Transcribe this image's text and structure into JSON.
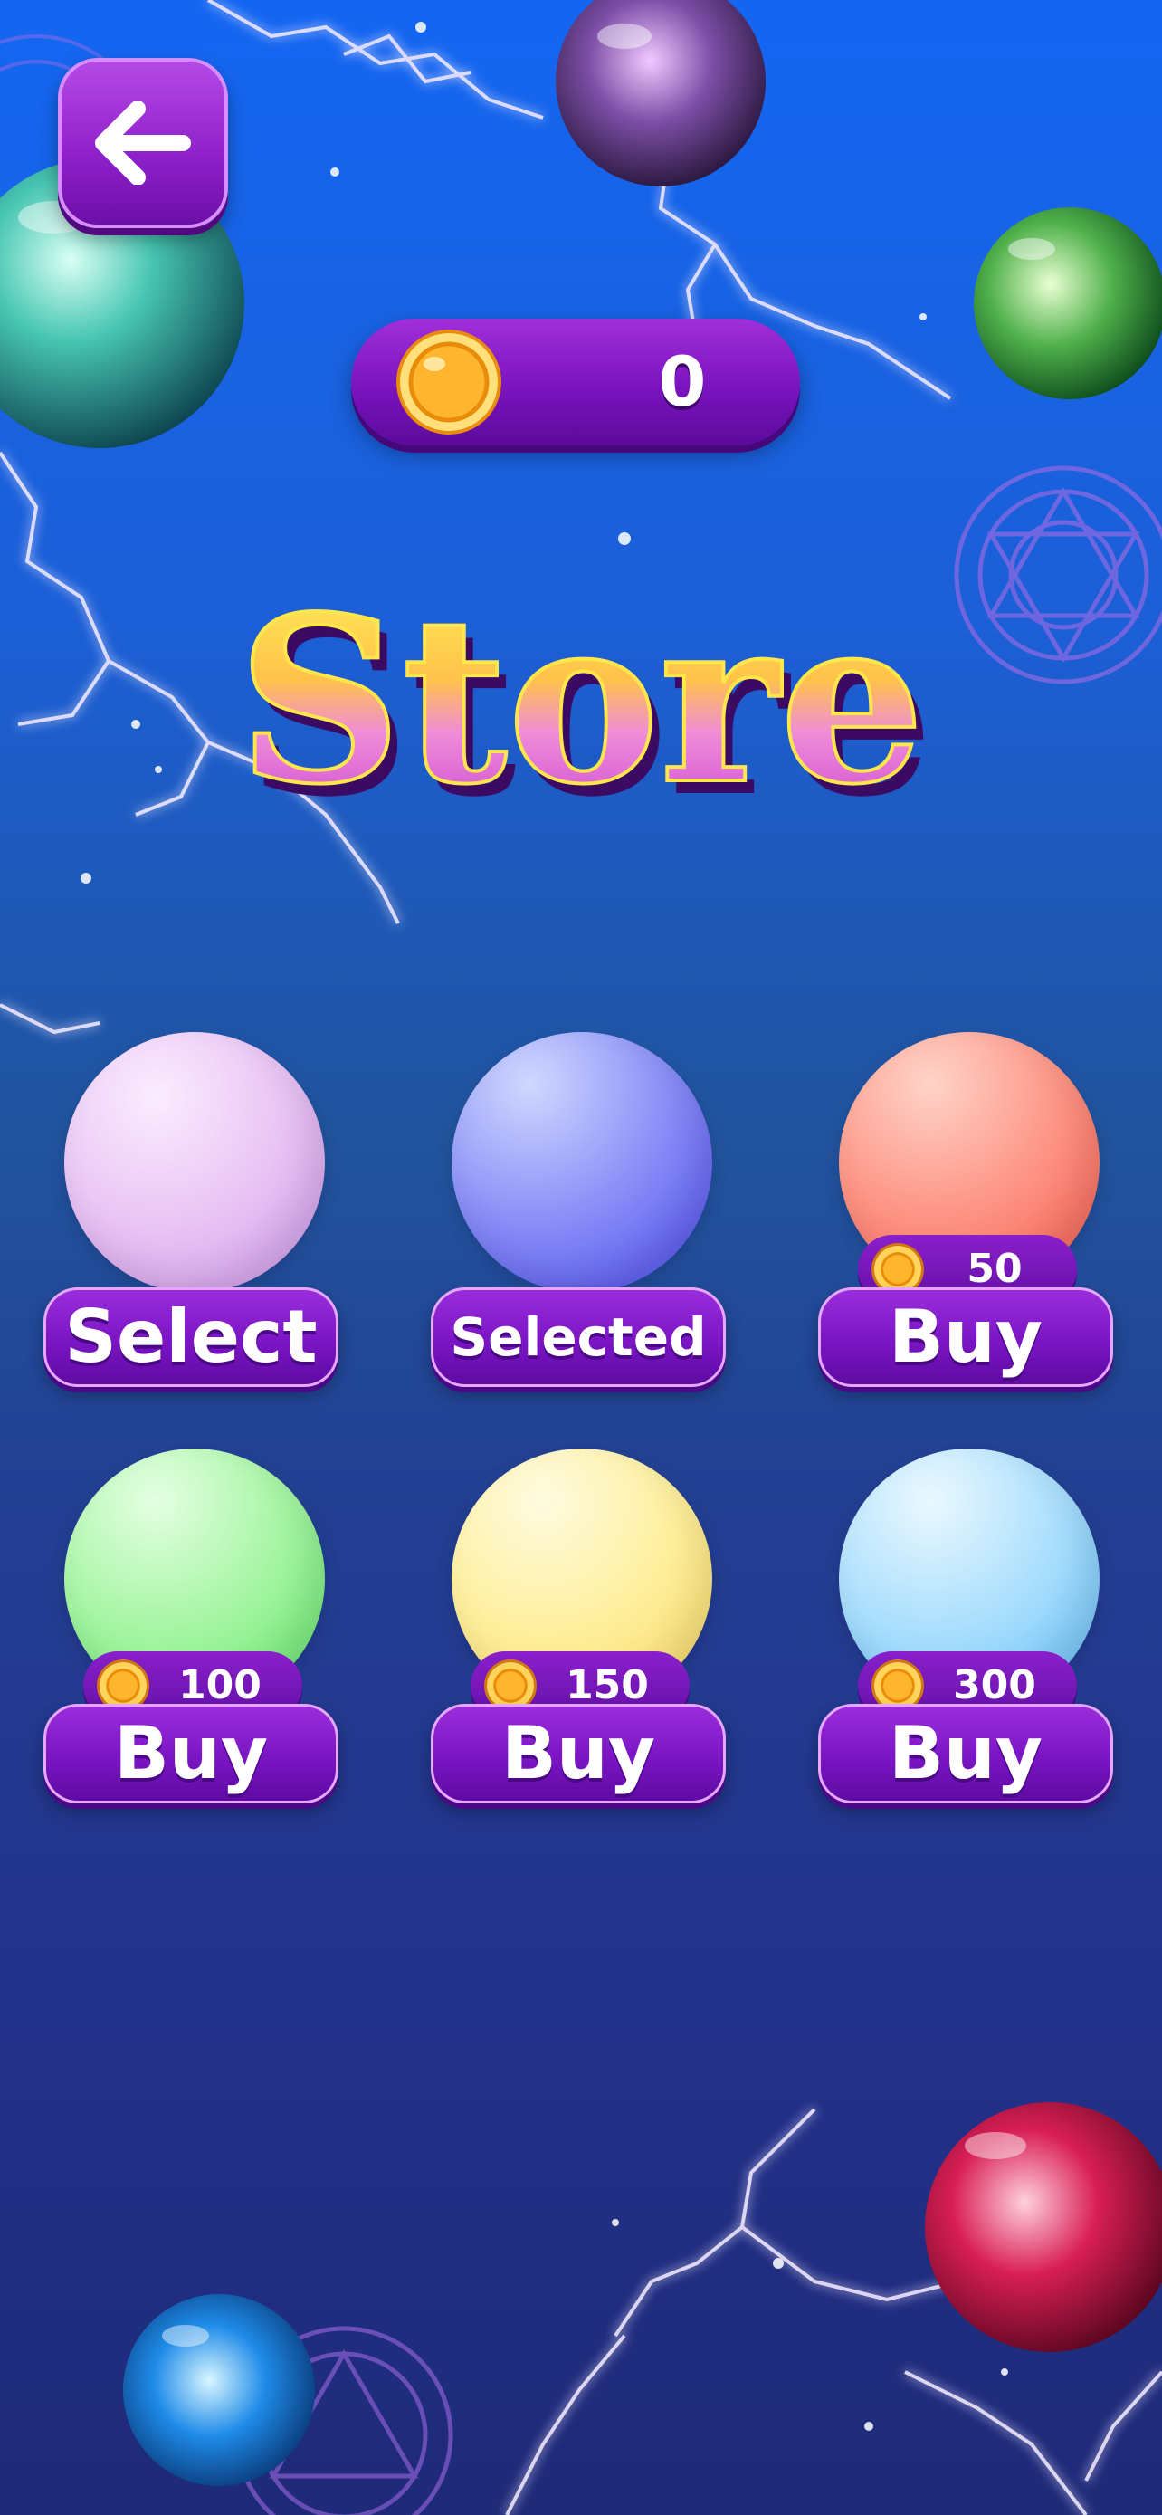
{
  "screen": {
    "title": "Store",
    "back_button_label": "Back"
  },
  "wallet": {
    "coins": "0",
    "icon": "coin-icon"
  },
  "items": [
    {
      "ball_color": "#dcaef0",
      "price": null,
      "button_label": "Select",
      "state": "owned"
    },
    {
      "ball_color": "#6b6ef5",
      "price": null,
      "button_label": "Selected",
      "state": "selected"
    },
    {
      "ball_color": "#fb7a6d",
      "price": "50",
      "button_label": "Buy",
      "state": "locked"
    },
    {
      "ball_color": "#8ef28e",
      "price": "100",
      "button_label": "Buy",
      "state": "locked"
    },
    {
      "ball_color": "#fde882",
      "price": "150",
      "button_label": "Buy",
      "state": "locked"
    },
    {
      "ball_color": "#8ed2fb",
      "price": "300",
      "button_label": "Buy",
      "state": "locked"
    }
  ],
  "colors": {
    "accent_purple": "#7a15c4",
    "title_gradient_top": "#ffe033",
    "title_gradient_bottom": "#e04fe0",
    "background_top": "#1466f2",
    "background_bottom": "#1f2a78"
  }
}
